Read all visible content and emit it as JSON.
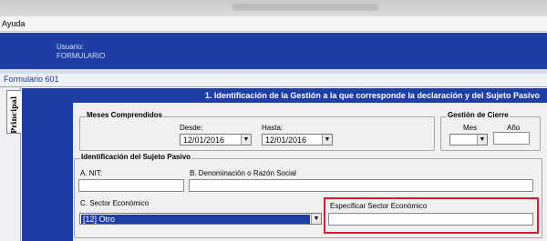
{
  "menu": {
    "help_label": "Ayuda"
  },
  "header": {
    "user_label": "Usuario:",
    "user_value": "FORMULARIO"
  },
  "form": {
    "title": "Formulario 601"
  },
  "tabs": [
    {
      "label": "Principal"
    }
  ],
  "section": {
    "title": "1. Identificación de la Gestión a la que corresponde la declaración y del Sujeto Pasivo"
  },
  "meses": {
    "title": "Meses Comprendidos",
    "desde_label": "Desde:",
    "desde_value": "12/01/2016",
    "hasta_label": "Hasta:",
    "hasta_value": "12/01/2016"
  },
  "gestion": {
    "title": "Gestión de Cierre",
    "mes_label": "Mes",
    "anio_label": "Año",
    "mes_value": "",
    "anio_value": ""
  },
  "sujeto": {
    "title": "Identificación del Sujeto Pasivo",
    "nit_label": "A. NIT:",
    "nit_value": "",
    "razon_label": "B. Denominación o Razón Social",
    "razon_value": "",
    "sector_label": "C. Sector Económico",
    "sector_value": "[12] Otro",
    "especificar_label": "Especificar Sector Económico",
    "especificar_value": ""
  },
  "icons": {
    "dropdown": "chevron-down-icon"
  }
}
